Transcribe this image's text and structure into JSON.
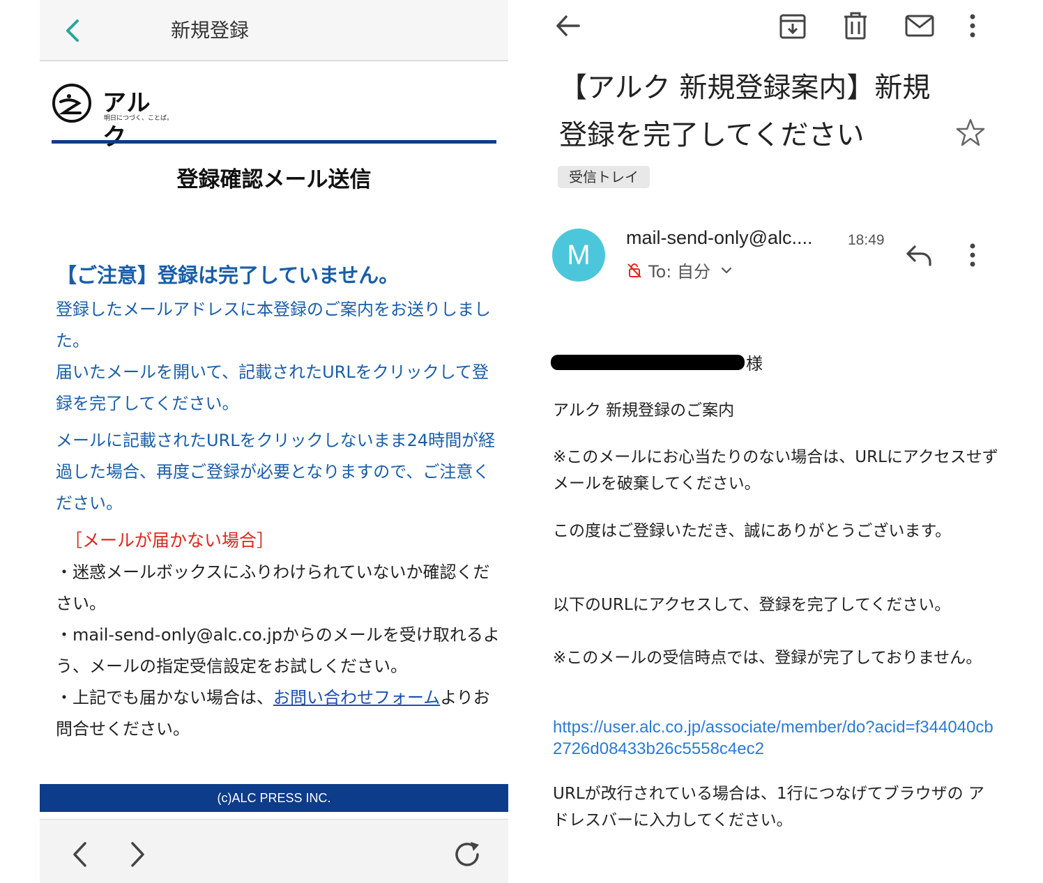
{
  "left": {
    "app_bar": {
      "title": "新規登録",
      "back_icon": "chevron-left-icon"
    },
    "logo": {
      "name": "アルク",
      "tagline": "明日につづく、ことば。"
    },
    "heading": "登録確認メール送信",
    "notice_title": "【ご注意】登録は完了していません。",
    "paragraphs": [
      "登録したメールアドレスに本登録のご案内をお送りしました。",
      "届いたメールを開いて、記載されたURLをクリックして登録を完了してください。",
      "メールに記載されたURLをクリックしないまま24時間が経過した場合、再度ご登録が必要となりますので、ご注意ください。"
    ],
    "no_mail_title": "［メールが届かない場合］",
    "bullets": {
      "b1": "・迷惑メールボックスにふりわけられていないか確認ください。",
      "b2": "・mail-send-only@alc.co.jpからのメールを受け取れるよう、メールの指定受信設定をお試しください。",
      "b3_pre": "・上記でも届かない場合は、",
      "b3_link": "お問い合わせフォーム",
      "b3_post": "よりお問合せください。"
    },
    "footer": "(c)ALC PRESS INC.",
    "browser_nav": {
      "back_icon": "chevron-left-icon",
      "forward_icon": "chevron-right-icon",
      "reload_icon": "reload-icon"
    },
    "colors": {
      "brand_blue": "#0d3c8a",
      "text_blue": "#1a5ea8",
      "warning_red": "#d9281e"
    }
  },
  "right": {
    "toolbar": {
      "back_icon": "arrow-left-icon",
      "archive_icon": "archive-icon",
      "delete_icon": "trash-icon",
      "mark_unread_icon": "mail-icon",
      "more_icon": "more-vertical-icon"
    },
    "subject": "【アルク 新規登録案内】新規登録を完了してください",
    "label": "受信トレイ",
    "sender": {
      "avatar_letter": "M",
      "name": "mail-send-only@alc....",
      "time": "18:49",
      "to": "To: 自分"
    },
    "body": {
      "recipient_suffix": "様",
      "line1": "アルク 新規登録のご案内",
      "line2": "※このメールにお心当たりのない場合は、URLにアクセスせずメールを破棄してください。",
      "line3": "この度はご登録いただき、誠にありがとうございます。",
      "line4": "以下のURLにアクセスして、登録を完了してください。",
      "line5": "※このメールの受信時点では、登録が完了しておりません。",
      "url": "https://user.alc.co.jp/associate/member/do?acid=f344040cb2726d08433b26c5558c4ec2",
      "line6": "URLが改行されている場合は、1行につなげてブラウザの アドレスバーに入力してください。"
    },
    "colors": {
      "avatar": "#4cc6da",
      "link": "#2a7ad6"
    }
  }
}
